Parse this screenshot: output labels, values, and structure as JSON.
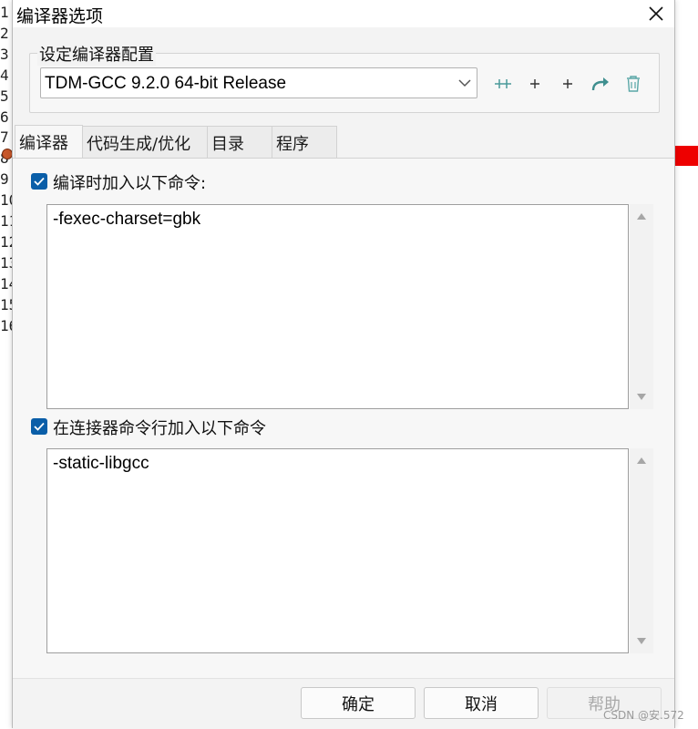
{
  "background": {
    "line_numbers": [
      "1",
      "2",
      "3",
      "4",
      "5",
      "6",
      "7",
      "8",
      "9",
      "10",
      "11",
      "12",
      "13",
      "14",
      "15",
      "16"
    ]
  },
  "dialog": {
    "title": "编译器选项",
    "config_group_label": "设定编译器配置",
    "config_selected": "TDM-GCC 9.2.0 64-bit Release",
    "toolbar": [
      {
        "name": "add-compiler-icon",
        "glyph": "+"
      },
      {
        "name": "add-icon",
        "glyph": "+"
      },
      {
        "name": "add-alt-icon",
        "glyph": "+"
      },
      {
        "name": "rename-icon",
        "glyph": "↷"
      },
      {
        "name": "trash-icon",
        "glyph": "🗑"
      }
    ],
    "tabs": [
      "编译器",
      "代码生成/优化",
      "目录",
      "程序"
    ],
    "active_tab": 0,
    "compile_option": {
      "checked": true,
      "label": "编译时加入以下命令:",
      "value": "-fexec-charset=gbk"
    },
    "linker_option": {
      "checked": true,
      "label": "在连接器命令行加入以下命令",
      "value": "-static-libgcc"
    },
    "buttons": {
      "ok": "确定",
      "cancel": "取消",
      "help": "帮助"
    },
    "accent_color": "#0a5ea8"
  },
  "watermark": "CSDN @安.572"
}
